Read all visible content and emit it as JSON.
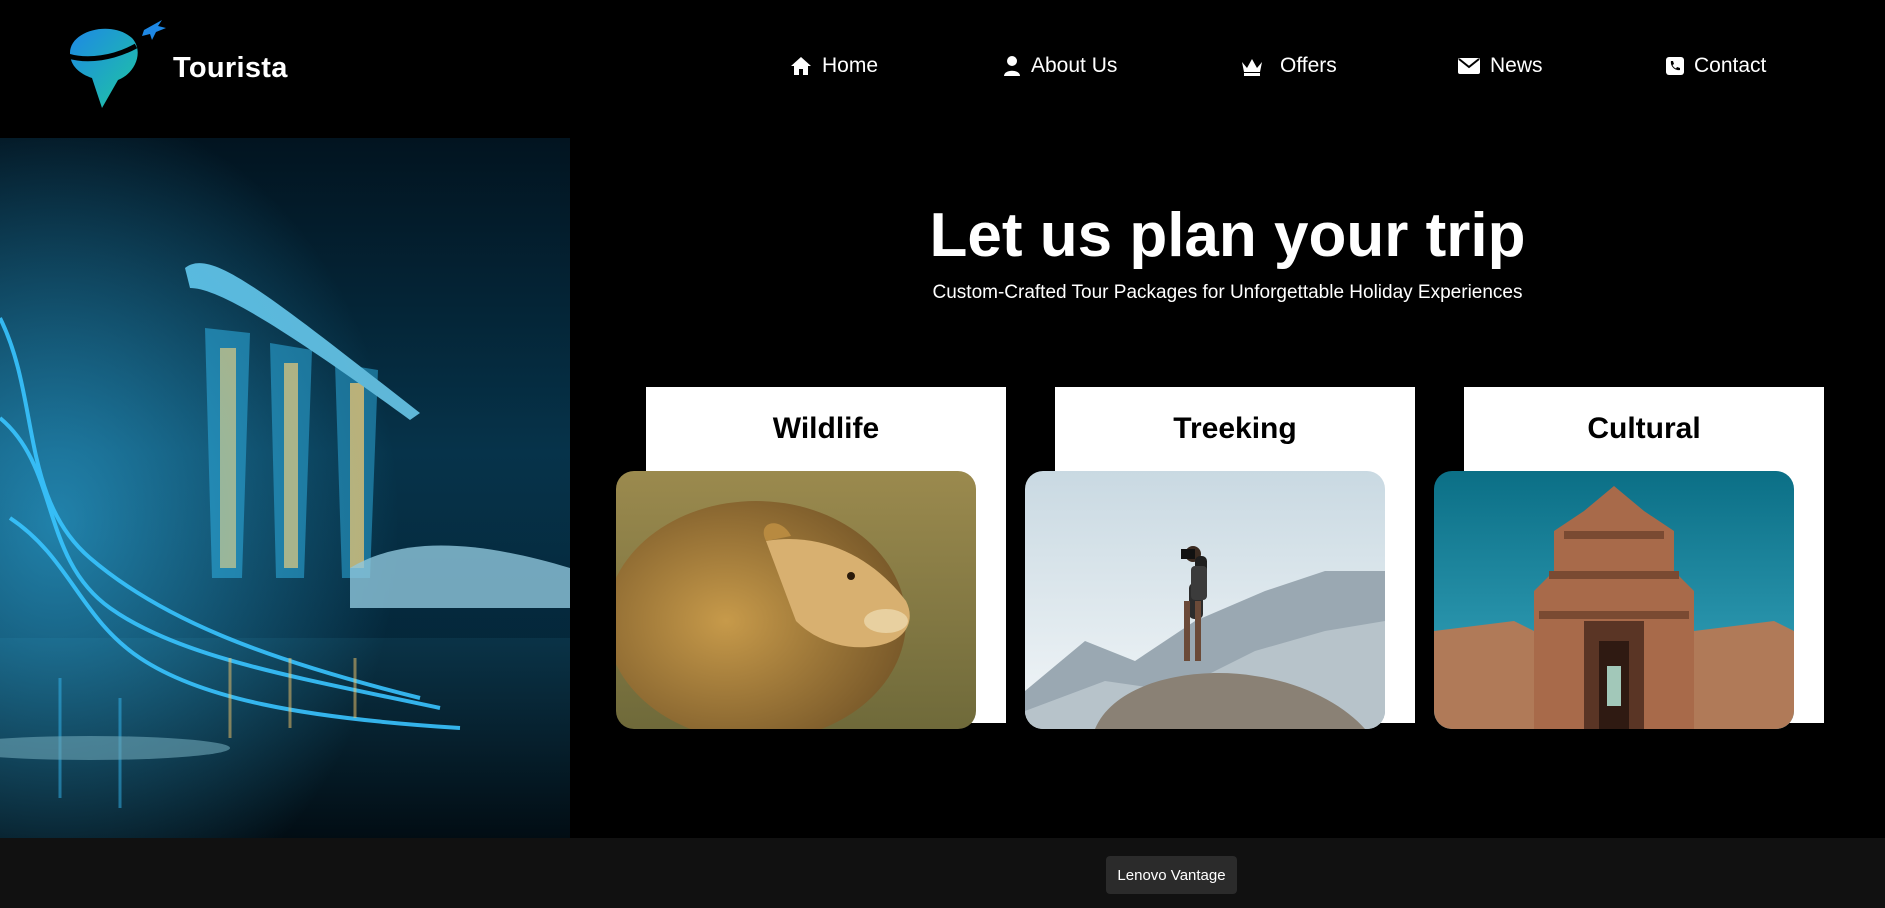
{
  "brand": {
    "name": "Tourista"
  },
  "nav": {
    "items": [
      {
        "label": "Home",
        "icon": "home-icon"
      },
      {
        "label": "About Us",
        "icon": "user-icon"
      },
      {
        "label": "Offers",
        "icon": "crown-icon"
      },
      {
        "label": "News",
        "icon": "envelope-icon"
      },
      {
        "label": "Contact",
        "icon": "phone-icon"
      }
    ]
  },
  "hero": {
    "title": "Let us plan your trip",
    "subtitle": "Custom-Crafted Tour Packages for Unforgettable Holiday Experiences"
  },
  "categories": [
    {
      "label": "Wildlife",
      "image": "lion-photo"
    },
    {
      "label": "Treeking",
      "image": "hiker-photographer-photo"
    },
    {
      "label": "Cultural",
      "image": "temple-photo"
    }
  ],
  "taskbar": {
    "app_label": "Lenovo Vantage"
  },
  "colors": {
    "background": "#000000",
    "taskbar": "#111111",
    "card": "#ffffff",
    "accent_blue": "#1e88e5",
    "accent_teal": "#1fc7a0"
  }
}
